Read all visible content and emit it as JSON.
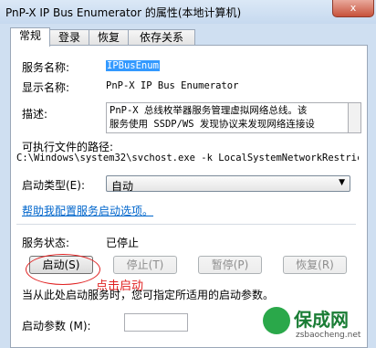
{
  "window": {
    "title": "PnP-X IP Bus Enumerator 的属性(本地计算机)",
    "close_label": "x"
  },
  "tabs": [
    {
      "label": "常规",
      "active": true
    },
    {
      "label": "登录",
      "active": false
    },
    {
      "label": "恢复",
      "active": false
    },
    {
      "label": "依存关系",
      "active": false
    }
  ],
  "general": {
    "service_name_label": "服务名称:",
    "service_name_value": "IPBusEnum",
    "display_name_label": "显示名称:",
    "display_name_value": "PnP-X IP Bus Enumerator",
    "description_label": "描述:",
    "description_line1": "PnP-X 总线枚举器服务管理虚拟网络总线。该",
    "description_line2": "服务使用 SSDP/WS 发现协议来发现网络连接设",
    "exe_path_label": "可执行文件的路径:",
    "exe_path_value": "C:\\Windows\\system32\\svchost.exe -k LocalSystemNetworkRestric",
    "startup_type_label": "启动类型(E):",
    "startup_type_value": "自动",
    "help_link": "帮助我配置服务启动选项。",
    "status_label": "服务状态:",
    "status_value": "已停止",
    "start_params_hint": "当从此处启动服务时，您可指定所适用的启动参数。",
    "start_params_label": "启动参数 (M):",
    "start_params_value": ""
  },
  "buttons": {
    "start": "启动(S)",
    "stop": "停止(T)",
    "pause": "暂停(P)",
    "resume": "恢复(R)"
  },
  "annotation": {
    "text": "点击启动",
    "color": "#e02020"
  },
  "watermark": {
    "title": "保成网",
    "url": "zsbaocheng.net"
  },
  "colors": {
    "link": "#0066cc",
    "selection": "#3399ff",
    "window_frame": "#cfdff1"
  },
  "icons": {
    "dropdown": "chevron-down-icon",
    "close": "close-icon"
  }
}
